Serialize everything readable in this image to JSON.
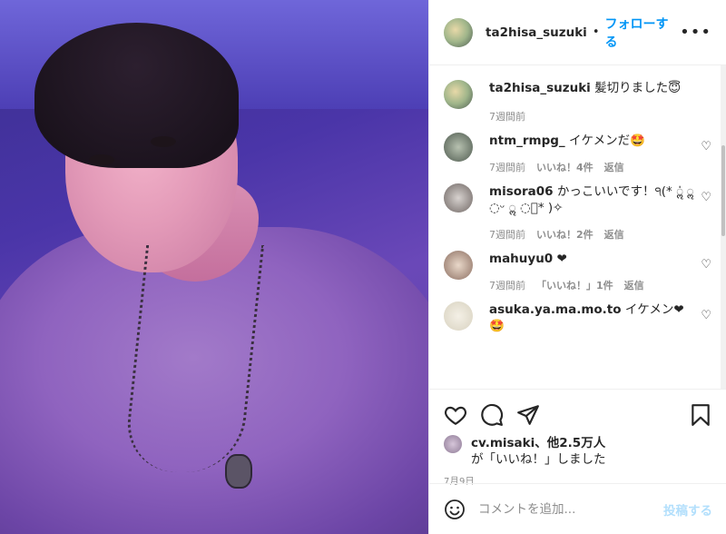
{
  "header": {
    "username": "ta2hisa_suzuki",
    "separator": "•",
    "follow_label": "フォローする",
    "more_label": "•••"
  },
  "caption": {
    "username": "ta2hisa_suzuki",
    "text": "髪切りました😇",
    "time": "7週間前"
  },
  "comments": [
    {
      "username": "ntm_rmpg_",
      "text": "イケメンだ🤩",
      "time": "7週間前",
      "likes": "いいね！4件",
      "reply": "返信"
    },
    {
      "username": "misora06",
      "text": "かっこいいです！੧(* ॢ̍ ॢ ◌ᵕ ॢ ◌⃝* )✧",
      "time": "7週間前",
      "likes": "いいね！2件",
      "reply": "返信"
    },
    {
      "username": "mahuyu0",
      "text": "❤",
      "time": "7週間前",
      "likes": "「いいね！」1件",
      "reply": "返信"
    },
    {
      "username": "asuka.ya.ma.mo.to",
      "text": "イケメン❤🤩",
      "time": "",
      "likes": "",
      "reply": ""
    }
  ],
  "likes": {
    "liker": "cv.misaki",
    "others": "、他2.5万人",
    "suffix": "が「いいね！」しました"
  },
  "date": "7月9日",
  "composer": {
    "placeholder": "コメントを追加...",
    "post_label": "投稿する"
  },
  "colors": {
    "accent": "#0095f6",
    "post_disabled": "#b2dffc",
    "muted": "#8e8e8e"
  },
  "icons": [
    "heart-icon",
    "comment-icon",
    "share-icon",
    "bookmark-icon",
    "emoji-icon"
  ]
}
